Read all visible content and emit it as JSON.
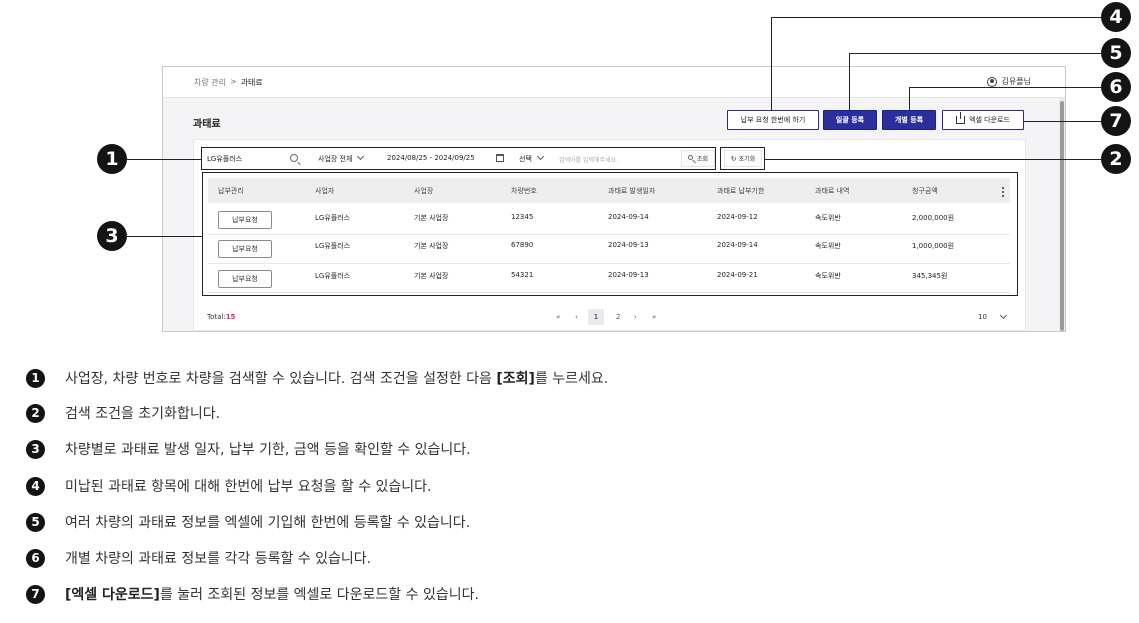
{
  "topbar": {
    "breadcrumb": [
      "차량 관리",
      ">",
      "과태료"
    ],
    "user_name": "김유플님"
  },
  "page_title": "과태료",
  "toolbar": {
    "bulk_pay_request": "납부 요청 한번에 하기",
    "bulk_register": "일괄 등록",
    "individual_register": "개별 등록",
    "excel_download": "엑셀 다운로드"
  },
  "filters": {
    "company": "LG유플러스",
    "site_select": "사업장 전체",
    "date_range": "2024/08/25 - 2024/09/25",
    "select": "선택",
    "search_placeholder": "검색어를 입력해주세요.",
    "search_button": "조회",
    "reset_button": "초기화"
  },
  "table": {
    "headers": [
      "납부관리",
      "사업자",
      "사업장",
      "차량번호",
      "과태료 발생일자",
      "과태료 납부기한",
      "과태료 내역",
      "청구금액"
    ],
    "rows": [
      {
        "action": "납부요청",
        "company": "LG유플러스",
        "site": "기본 사업장",
        "vehicle": "12345",
        "issued": "2024-09-14",
        "due": "2024-09-12",
        "type": "속도위반",
        "amount": "2,000,000원"
      },
      {
        "action": "납부요청",
        "company": "LG유플러스",
        "site": "기본 사업장",
        "vehicle": "67890",
        "issued": "2024-09-13",
        "due": "2024-09-14",
        "type": "속도위반",
        "amount": "1,000,000원"
      },
      {
        "action": "납부요청",
        "company": "LG유플러스",
        "site": "기본 사업장",
        "vehicle": "54321",
        "issued": "2024-09-13",
        "due": "2024-09-21",
        "type": "속도위반",
        "amount": "345,345원"
      }
    ]
  },
  "footer": {
    "total_label": "Total:",
    "total_count": "15",
    "pager": {
      "first": "«",
      "prev": "‹",
      "pages": [
        "1",
        "2"
      ],
      "next": "›",
      "last": "»"
    },
    "page_size": "10"
  },
  "callouts": [
    "1",
    "2",
    "3",
    "4",
    "5",
    "6",
    "7"
  ],
  "descriptions": [
    {
      "num": "1",
      "pre": "사업장, 차량 번호로 차량을 검색할 수 있습니다. 검색 조건을 설정한 다음 ",
      "bold": "[조회]",
      "post": "를 누르세요."
    },
    {
      "num": "2",
      "pre": "검색 조건을 초기화합니다.",
      "bold": "",
      "post": ""
    },
    {
      "num": "3",
      "pre": "차량별로 과태료 발생 일자, 납부 기한, 금액 등을 확인할 수 있습니다.",
      "bold": "",
      "post": ""
    },
    {
      "num": "4",
      "pre": "미납된 과태료 항목에 대해 한번에 납부 요청을 할 수 있습니다.",
      "bold": "",
      "post": ""
    },
    {
      "num": "5",
      "pre": "여러 차량의 과태료 정보를 엑셀에 기입해 한번에 등록할 수 있습니다.",
      "bold": "",
      "post": ""
    },
    {
      "num": "6",
      "pre": "개별 차량의 과태료 정보를 각각 등록할 수 있습니다.",
      "bold": "",
      "post": ""
    },
    {
      "num": "7",
      "pre": "",
      "bold": "[엑셀 다운로드]",
      "post": "를 눌러 조회된 정보를 엑셀로 다운로드할 수 있습니다."
    }
  ]
}
